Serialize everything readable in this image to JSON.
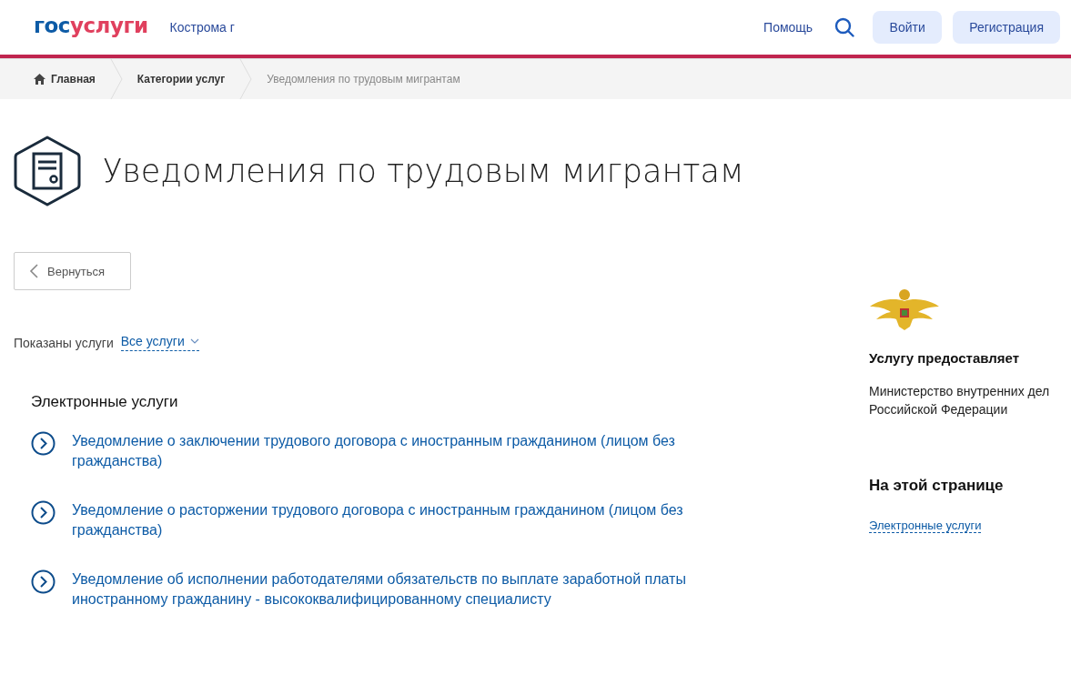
{
  "header": {
    "logo": [
      {
        "text": "гос",
        "color": "#0d5ba6"
      },
      {
        "text": "услуги",
        "color": "#e0405e"
      }
    ],
    "city": "Кострома г",
    "help": "Помощь",
    "buttons": [
      "Войти",
      "Регистрация"
    ]
  },
  "breadcrumbs": [
    {
      "label": "Главная",
      "home": true,
      "current": false
    },
    {
      "label": "Категории услуг",
      "home": false,
      "current": false
    },
    {
      "label": "Уведомления по трудовым мигрантам",
      "home": false,
      "current": true
    }
  ],
  "title": "Уведомления по трудовым мигрантам",
  "back_button": "Вернуться",
  "filter": {
    "label": "Показаны услуги",
    "value": "Все услуги"
  },
  "section_title": "Электронные услуги",
  "services": [
    "Уведомление о заключении трудового договора с иностранным гражданином (лицом без гражданства)",
    "Уведомление о расторжении трудового договора с иностранным гражданином (лицом без гражданства)",
    "Уведомление об исполнении работодателями обязательств по выплате заработной платы иностранному гражданину - высококвалифицированному специалисту"
  ],
  "sidebar": {
    "provider_title": "Услугу предоставляет",
    "provider": "Министерство внутренних дел Российской Федерации",
    "toc_title": "На этой странице",
    "toc_links": [
      "Электронные услуги"
    ]
  }
}
